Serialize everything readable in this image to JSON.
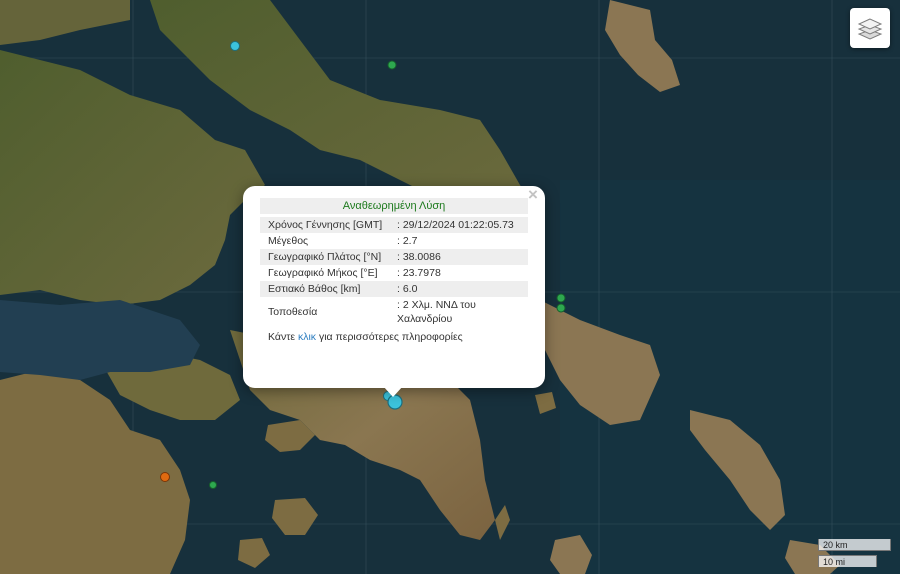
{
  "popup": {
    "title": "Αναθεωρημένη Λύση",
    "rows": [
      {
        "label": "Χρόνος Γέννησης [GMT]",
        "value": ": 29/12/2024 01:22:05.73"
      },
      {
        "label": "Μέγεθος",
        "value": ": 2.7"
      },
      {
        "label": "Γεωγραφικό Πλάτος [°N]",
        "value": ": 38.0086"
      },
      {
        "label": "Γεωγραφικό Μήκος [°E]",
        "value": ": 23.7978"
      },
      {
        "label": "Εστιακό Βάθος [km]",
        "value": ": 6.0"
      },
      {
        "label": "Τοποθεσία",
        "value": ": 2 Χλμ. ΝΝΔ του Χαλανδρίου"
      }
    ],
    "more_before": "Κάντε ",
    "more_link": "κλικ",
    "more_after": " για περισσότερες πληροφορίες",
    "close_symbol": "×"
  },
  "scale": {
    "km": "20 km",
    "mi": "10 mi"
  },
  "controls": {
    "layers_icon": "layers-icon"
  },
  "colors": {
    "sea": "#17303c",
    "land": "#7a6a45",
    "marker_selected": "#3cc3dc",
    "marker_green": "#2ea84f",
    "marker_orange": "#e06a10"
  }
}
